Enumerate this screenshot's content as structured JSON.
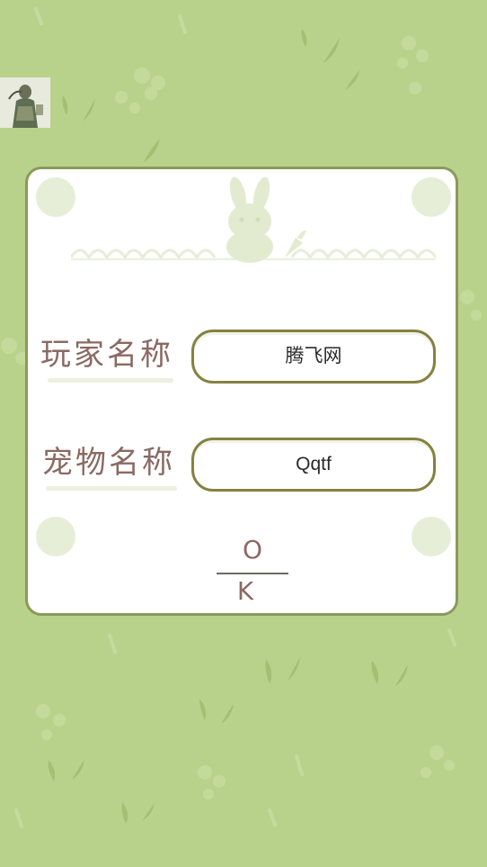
{
  "player": {
    "avatar_icon": "player-portrait-icon"
  },
  "dialog": {
    "header_art": "rabbit-carrot-icon",
    "player_name_label": "玩家名称",
    "player_name_value": "腾飞网",
    "pet_name_label": "宠物名称",
    "pet_name_value": "Qqtf",
    "ok_label": "O K"
  },
  "colors": {
    "background": "#b9d28b",
    "dialog_border": "#8a9a5c",
    "input_border": "#848240",
    "label_text": "#8a6a63"
  }
}
